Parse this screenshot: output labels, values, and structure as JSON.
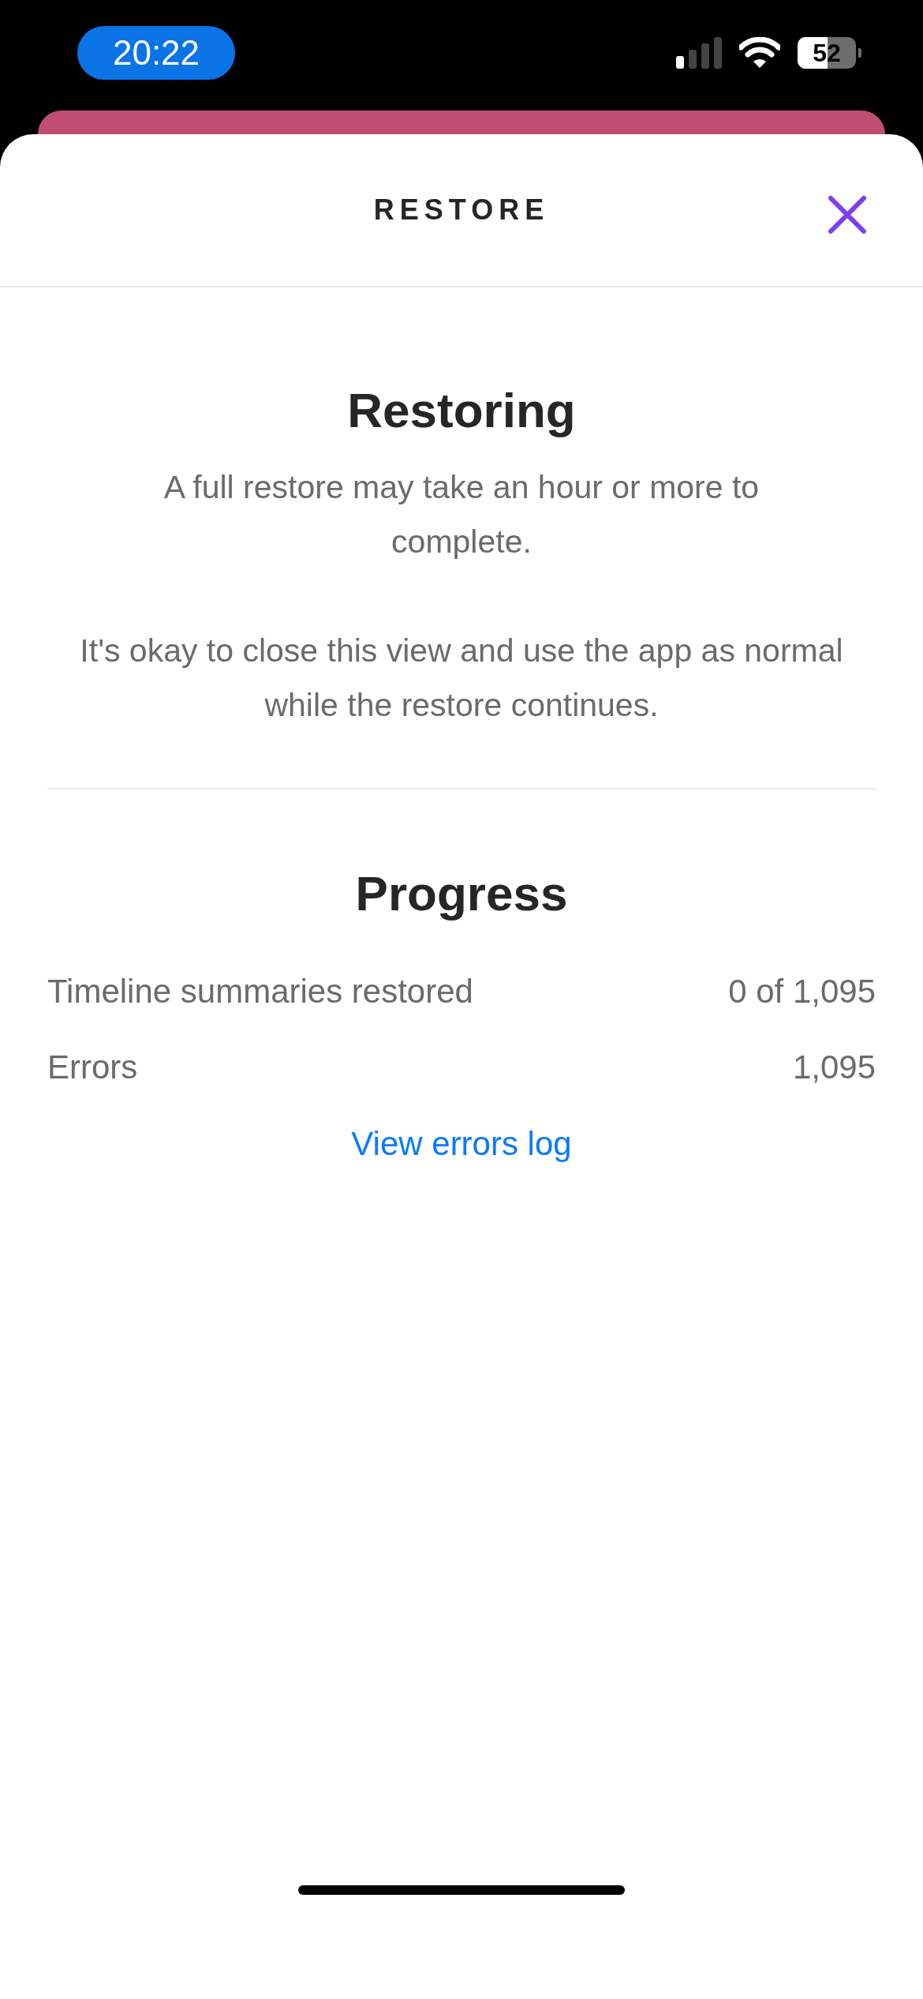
{
  "status_bar": {
    "time": "20:22",
    "battery": "52"
  },
  "header": {
    "title": "RESTORE"
  },
  "intro": {
    "title": "Restoring",
    "paragraphs": [
      "A full restore may take an hour or more to complete.",
      "It's okay to close this view and use the app as normal while the restore continues."
    ]
  },
  "progress": {
    "title": "Progress",
    "rows": [
      {
        "label": "Timeline summaries restored",
        "value": "0 of 1,095"
      },
      {
        "label": "Errors",
        "value": "1,095"
      }
    ],
    "link": "View errors log"
  }
}
